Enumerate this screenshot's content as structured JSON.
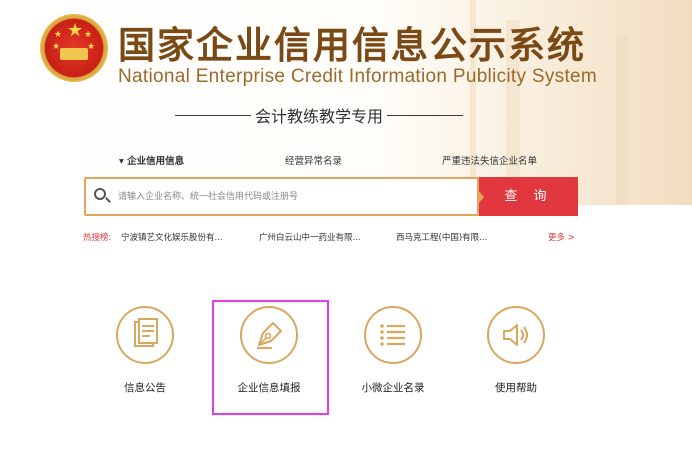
{
  "header": {
    "title_cn": "国家企业信用信息公示系统",
    "title_en": "National Enterprise Credit Information Publicity System",
    "subtitle": "会计教练教学专用"
  },
  "tabs": [
    {
      "label": "▾ 企业信用信息",
      "active": true
    },
    {
      "label": "经营异常名录",
      "active": false
    },
    {
      "label": "严重违法失信企业名单",
      "active": false
    }
  ],
  "search": {
    "placeholder": "请输入企业名称、统一社会信用代码或注册号",
    "button_label": "查 询"
  },
  "hot_list": {
    "label": "热搜榜:",
    "items": [
      "宁波镇艺文化娱乐股份有...",
      "广州白云山中一药业有限...",
      "西马克工程(中国)有限..."
    ],
    "more_label": "更多 >"
  },
  "features": [
    {
      "label": "信息公告",
      "icon": "document-icon"
    },
    {
      "label": "企业信息填报",
      "icon": "pen-icon"
    },
    {
      "label": "小微企业名录",
      "icon": "list-icon"
    },
    {
      "label": "使用帮助",
      "icon": "speaker-icon"
    }
  ],
  "colors": {
    "brand_brown": "#7a4a16",
    "accent_red": "#e0383e",
    "gold": "#d9a860",
    "highlight": "#e23de6"
  }
}
